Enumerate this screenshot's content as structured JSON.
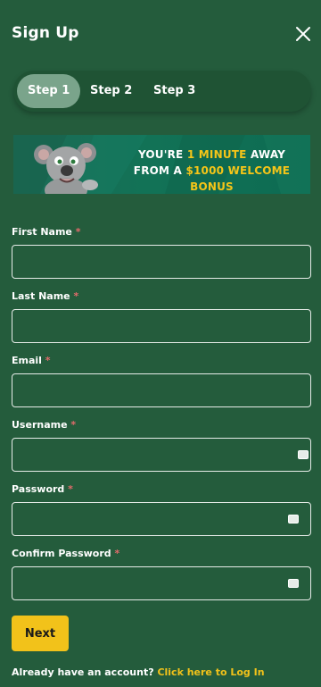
{
  "colors": {
    "background": "#245c3c",
    "accent": "#f2c21a",
    "required": "#e26b6b",
    "active_step": "#7aa48b"
  },
  "header": {
    "title": "Sign Up",
    "close_icon": "close-icon"
  },
  "stepper": {
    "steps": [
      {
        "label": "Step 1",
        "active": true
      },
      {
        "label": "Step 2",
        "active": false
      },
      {
        "label": "Step 3",
        "active": false
      }
    ]
  },
  "banner": {
    "line1_prefix": "You're",
    "line1_highlight": "1 minute",
    "line1_suffix": "away",
    "line2_prefix": "from a",
    "line2_highlight": "$1000 welcome bonus",
    "mascot": "koala-mascot"
  },
  "form": {
    "required_marker": "*",
    "fields": [
      {
        "label": "First Name",
        "value": "",
        "password_icon": false
      },
      {
        "label": "Last Name",
        "value": "",
        "password_icon": false
      },
      {
        "label": "Email",
        "value": "",
        "password_icon": false
      },
      {
        "label": "Username",
        "value": "",
        "password_icon": true
      },
      {
        "label": "Password",
        "value": "",
        "password_icon": true
      },
      {
        "label": "Confirm Password",
        "value": "",
        "password_icon": true
      }
    ],
    "next_label": "Next"
  },
  "footer": {
    "prompt": "Already have an account?",
    "link": "Click here to Log In"
  }
}
